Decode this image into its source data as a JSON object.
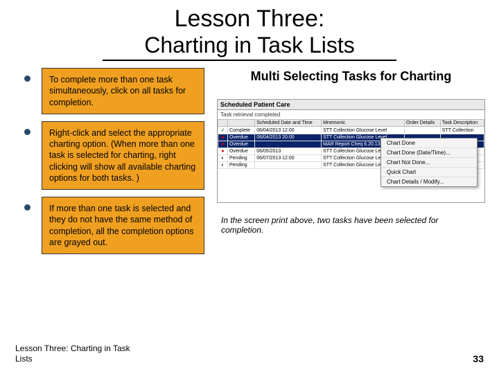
{
  "title": {
    "main": "Lesson Three:",
    "sub": "Charting in Task Lists"
  },
  "bullets": [
    "To complete more than one task simultaneously, click on all tasks for completion.",
    "Right-click and select the appropriate charting option. (When more than one task is selected for charting, right clicking will show all available charting options for both tasks. )",
    "If more than one task is selected and they do not have the same method of completion, all the completion options are grayed out."
  ],
  "right": {
    "heading": "Multi Selecting Tasks for Charting",
    "caption": "In the screen print above, two tasks have been selected for completion."
  },
  "screenshot": {
    "panel_title": "Scheduled Patient Care",
    "filter_text": "Task retrieval completed",
    "columns": [
      "",
      "",
      "Scheduled Date and Time",
      "Mnemonic",
      "Order Details",
      "Task Description"
    ],
    "rows": [
      {
        "icon": "✓",
        "cls": "ck",
        "status": "Complete",
        "date": "06/04/2013 12:00",
        "mnemonic": "STT Collection Glucose Level",
        "details": "",
        "desc": "STT Collection",
        "selected": false
      },
      {
        "icon": "●",
        "cls": "rd",
        "status": "Overdue",
        "date": "06/04/2013 20:00",
        "mnemonic": "STT Collection Glucose Level",
        "details": "",
        "desc": "",
        "selected": true
      },
      {
        "icon": "●",
        "cls": "rd",
        "status": "Overdue",
        "date": "",
        "mnemonic": "MAR Report Cheq 6.20.13 09:10",
        "details": "",
        "desc": "",
        "selected": true
      },
      {
        "icon": "●",
        "cls": "rd",
        "status": "Overdue",
        "date": "06/05/2013",
        "mnemonic": "STT Collection Glucose Level",
        "details": "",
        "desc": "",
        "selected": false
      },
      {
        "icon": "◐",
        "cls": "",
        "status": "Pending",
        "date": "06/07/2013 12:00",
        "mnemonic": "STT Collection Glucose Level",
        "details": "",
        "desc": "",
        "selected": false
      },
      {
        "icon": "◐",
        "cls": "",
        "status": "Pending",
        "date": "",
        "mnemonic": "STT Collection Glucose Level",
        "details": "",
        "desc": "",
        "selected": false
      }
    ],
    "menu": [
      "Chart Done",
      "Chart Done (Date/Time)...",
      "Chart Not Done...",
      "Quick Chart",
      "Chart Details / Modify..."
    ]
  },
  "footer": {
    "left": "Lesson Three: Charting in Task Lists",
    "page": "33"
  }
}
